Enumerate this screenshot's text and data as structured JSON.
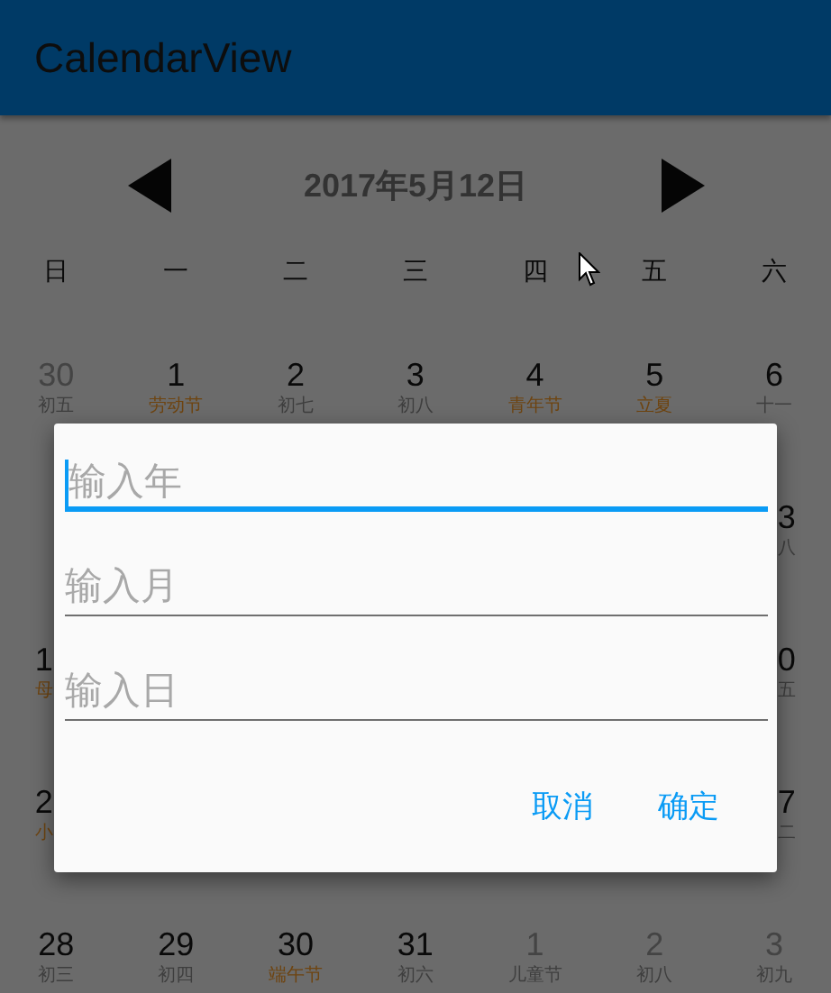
{
  "app_bar": {
    "title": "CalendarView"
  },
  "calendar": {
    "title": "2017年5月12日",
    "weekdays": [
      "日",
      "一",
      "二",
      "三",
      "四",
      "五",
      "六"
    ],
    "weeks": [
      {
        "kind": "full",
        "cells": [
          {
            "day": "30",
            "lunar": "初五",
            "in_month": false,
            "festival": false
          },
          {
            "day": "1",
            "lunar": "劳动节",
            "in_month": true,
            "festival": true
          },
          {
            "day": "2",
            "lunar": "初七",
            "in_month": true,
            "festival": false
          },
          {
            "day": "3",
            "lunar": "初八",
            "in_month": true,
            "festival": false
          },
          {
            "day": "4",
            "lunar": "青年节",
            "in_month": true,
            "festival": true
          },
          {
            "day": "5",
            "lunar": "立夏",
            "in_month": true,
            "festival": true
          },
          {
            "day": "6",
            "lunar": "十一",
            "in_month": true,
            "festival": false
          }
        ]
      },
      {
        "kind": "covered",
        "right": {
          "day": "3",
          "lunar": "八",
          "in_month": true,
          "festival": false
        }
      },
      {
        "kind": "covered",
        "left": {
          "day": "1",
          "lunar": "母",
          "in_month": true,
          "festival": true
        },
        "right": {
          "day": "0",
          "lunar": "五",
          "in_month": true,
          "festival": false
        }
      },
      {
        "kind": "covered",
        "left": {
          "day": "2",
          "lunar": "小",
          "in_month": true,
          "festival": true
        },
        "right": {
          "day": "7",
          "lunar": "二",
          "in_month": true,
          "festival": false
        }
      },
      {
        "kind": "full",
        "cells": [
          {
            "day": "28",
            "lunar": "初三",
            "in_month": true,
            "festival": false
          },
          {
            "day": "29",
            "lunar": "初四",
            "in_month": true,
            "festival": false
          },
          {
            "day": "30",
            "lunar": "端午节",
            "in_month": true,
            "festival": true
          },
          {
            "day": "31",
            "lunar": "初六",
            "in_month": true,
            "festival": false
          },
          {
            "day": "1",
            "lunar": "儿童节",
            "in_month": false,
            "festival": false
          },
          {
            "day": "2",
            "lunar": "初八",
            "in_month": false,
            "festival": false
          },
          {
            "day": "3",
            "lunar": "初九",
            "in_month": false,
            "festival": false
          }
        ]
      }
    ]
  },
  "dialog": {
    "fields": [
      {
        "placeholder": "输入年",
        "focused": true
      },
      {
        "placeholder": "输入月",
        "focused": false
      },
      {
        "placeholder": "输入日",
        "focused": false
      }
    ],
    "buttons": [
      "取消",
      "确定"
    ]
  }
}
